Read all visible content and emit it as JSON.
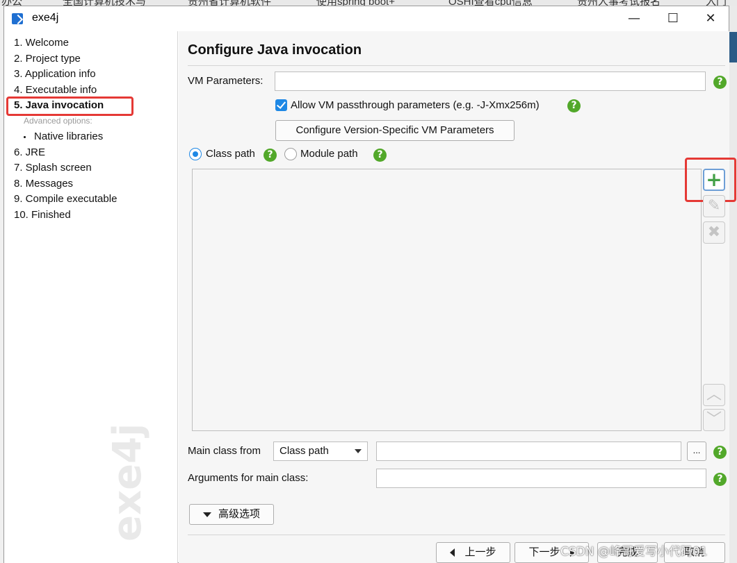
{
  "window": {
    "title": "exe4j",
    "minimize": "—",
    "maximize": "☐",
    "close": "✕"
  },
  "nav": {
    "items": [
      {
        "label": "1. Welcome"
      },
      {
        "label": "2. Project type"
      },
      {
        "label": "3. Application info"
      },
      {
        "label": "4. Executable info"
      },
      {
        "label": "5. Java invocation"
      },
      {
        "label": "6. JRE"
      },
      {
        "label": "7. Splash screen"
      },
      {
        "label": "8. Messages"
      },
      {
        "label": "9. Compile executable"
      },
      {
        "label": "10. Finished"
      }
    ],
    "active_index": 4,
    "advanced_label": "Advanced options:",
    "advanced_items": [
      {
        "label": "Native libraries"
      }
    ],
    "watermark": "exe4j"
  },
  "main": {
    "title": "Configure Java invocation",
    "vm_parameters_label": "VM Parameters:",
    "vm_parameters_value": "",
    "allow_passthrough_label": "Allow VM passthrough parameters (e.g. -J-Xmx256m)",
    "allow_passthrough_checked": true,
    "configure_version_button": "Configure Version-Specific VM Parameters",
    "class_path_label": "Class path",
    "module_path_label": "Module path",
    "selected_path_mode": "Class path",
    "side_buttons": {
      "add": "+",
      "edit": "✎",
      "remove": "✖",
      "up": "︿",
      "down": "﹀"
    },
    "main_class_from_label": "Main class from",
    "main_class_from_value": "Class path",
    "main_class_value": "",
    "browse_button": "...",
    "arguments_label": "Arguments for main class:",
    "arguments_value": "",
    "advanced_button": "高级选项",
    "help_icon_text": "?"
  },
  "footer": {
    "back_button": "上一步",
    "next_button": "下一步",
    "finish_button": "完成",
    "cancel_button": "取消"
  },
  "background": {
    "tabs": [
      "办公",
      "全国计算机技术与",
      "贵州省计算机软件",
      "使用spring boot+",
      "OSHI查看cpu信息",
      "贵州人事考试报名",
      "入门"
    ]
  },
  "overlay": {
    "watermark_text": "CSDN @峰哥爱写小代码01"
  },
  "colors": {
    "accent": "#1e88e5",
    "help_green": "#52a82a",
    "highlight_red": "#e53935",
    "add_green": "#43a047"
  }
}
